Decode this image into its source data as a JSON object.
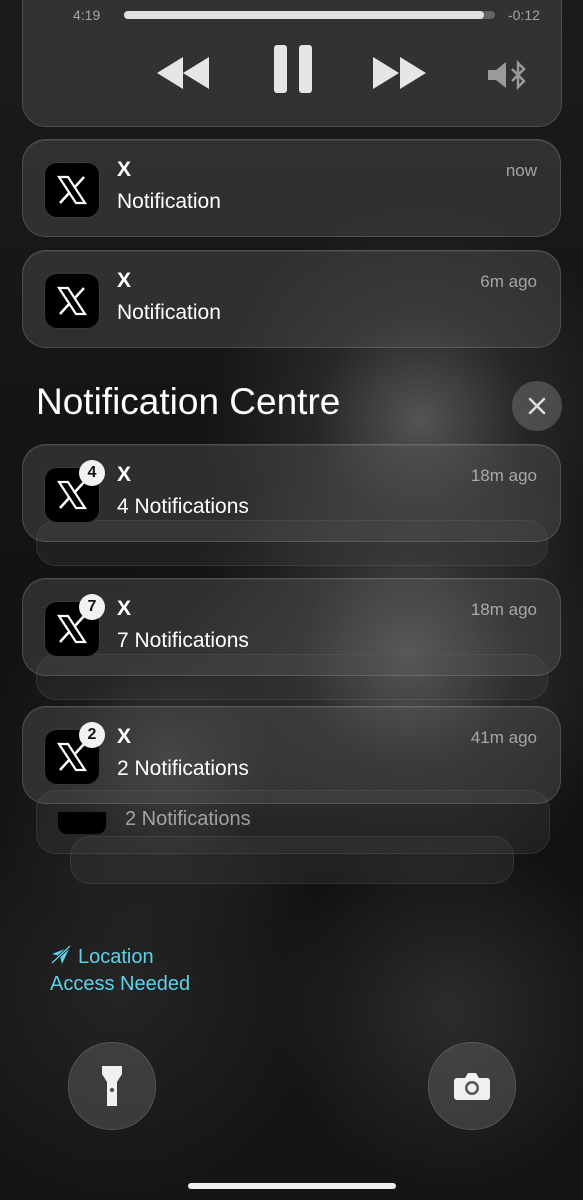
{
  "media_player": {
    "elapsed": "4:19",
    "remaining": "-0:12",
    "progress": 0.97,
    "rewind_icon": "rewind-icon",
    "pause_icon": "pause-icon",
    "forward_icon": "fast-forward-icon",
    "output_icon": "bluetooth-speaker-icon"
  },
  "notifications": [
    {
      "app": "X",
      "body": "Notification",
      "time": "now"
    },
    {
      "app": "X",
      "body": "Notification",
      "time": "6m ago"
    }
  ],
  "notification_centre": {
    "title": "Notification Centre",
    "close_icon": "close-icon"
  },
  "stacks": [
    {
      "app": "X",
      "badge": "4",
      "body": "4 Notifications",
      "time": "18m ago"
    },
    {
      "app": "X",
      "badge": "7",
      "body": "7 Notifications",
      "time": "18m ago"
    },
    {
      "app": "X",
      "badge": "2",
      "body": "2 Notifications",
      "time": "41m ago"
    }
  ],
  "expanded_stack_item": {
    "body": "2 Notifications"
  },
  "location_notice": {
    "icon": "location-slash-icon",
    "line1": "Location",
    "line2": "Access Needed",
    "color": "#5fd2e8"
  },
  "flashlight_icon": "flashlight-icon",
  "camera_icon": "camera-icon"
}
